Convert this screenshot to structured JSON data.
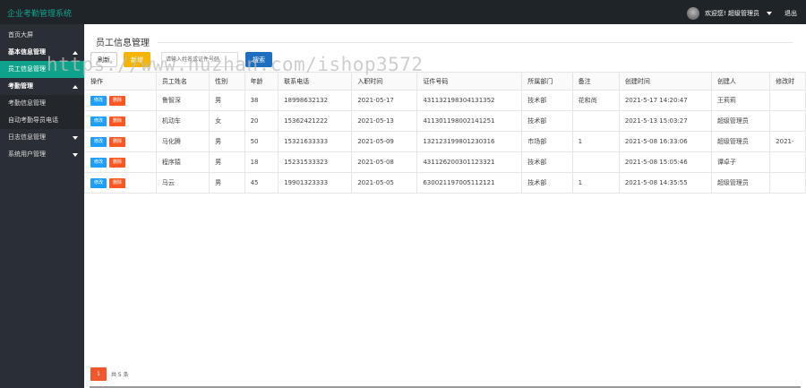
{
  "app": {
    "title": "企业考勤管理系统"
  },
  "header": {
    "welcome": "欢迎您! 超级管理员",
    "logout": "退出"
  },
  "sidebar": {
    "items": [
      {
        "label": "首页大屏",
        "type": "item"
      },
      {
        "label": "基本信息管理",
        "type": "parent",
        "expanded": true
      },
      {
        "label": "员工信息管理",
        "type": "sub",
        "active": true
      },
      {
        "label": "考勤管理",
        "type": "parent",
        "expanded": true
      },
      {
        "label": "考勤信息管理",
        "type": "sub"
      },
      {
        "label": "自动考勤导员电话",
        "type": "sub"
      },
      {
        "label": "日志信息管理",
        "type": "parent",
        "expanded": false
      },
      {
        "label": "系统用户管理",
        "type": "parent",
        "expanded": false
      }
    ]
  },
  "page": {
    "title": "员工信息管理"
  },
  "toolbar": {
    "refresh_label": "刷新",
    "add_label": "新增",
    "search_placeholder": "请输入姓名或证件号码",
    "search_label": "搜索"
  },
  "table": {
    "columns": [
      "操作",
      "员工姓名",
      "性别",
      "年龄",
      "联系电话",
      "入职时间",
      "证件号码",
      "所属部门",
      "备注",
      "创建时间",
      "创建人",
      "修改时"
    ],
    "edit_label": "修改",
    "delete_label": "删除",
    "rows": [
      [
        "",
        "鲁智深",
        "男",
        "38",
        "18998632132",
        "2021-05-17",
        "431132198304131352",
        "技术部",
        "花和尚",
        "2021-5-17 14:20:47",
        "王莉莉",
        ""
      ],
      [
        "",
        "机动车",
        "女",
        "20",
        "15362421222",
        "2021-05-13",
        "411301198002141251",
        "技术部",
        "",
        "2021-5-13 15:03:27",
        "超级管理员",
        ""
      ],
      [
        "",
        "马化腾",
        "男",
        "50",
        "15321633333",
        "2021-05-09",
        "132123199801230316",
        "市场部",
        "1",
        "2021-5-08 16:33:06",
        "超级管理员",
        "2021-"
      ],
      [
        "",
        "程序猿",
        "男",
        "18",
        "15231533323",
        "2021-05-08",
        "431126200301123321",
        "技术部",
        "",
        "2021-5-08 15:05:46",
        "谭卓子",
        ""
      ],
      [
        "",
        "马云",
        "男",
        "45",
        "19901323333",
        "2021-05-05",
        "630021197005112121",
        "技术部",
        "1",
        "2021-5-08 14:35:55",
        "超级管理员",
        ""
      ]
    ]
  },
  "pagination": {
    "current_page": "1",
    "total_text": "共 5 条"
  },
  "watermark": "https://www.huzhan.com/ishop3572",
  "colors": {
    "topbar": "#1f2428",
    "sidebar": "#2a2f35",
    "accent": "#0fa38c",
    "add_button": "#f4b400",
    "search_button": "#1e6fc0",
    "edit_button": "#1e9fff",
    "delete_button": "#ff5722"
  }
}
